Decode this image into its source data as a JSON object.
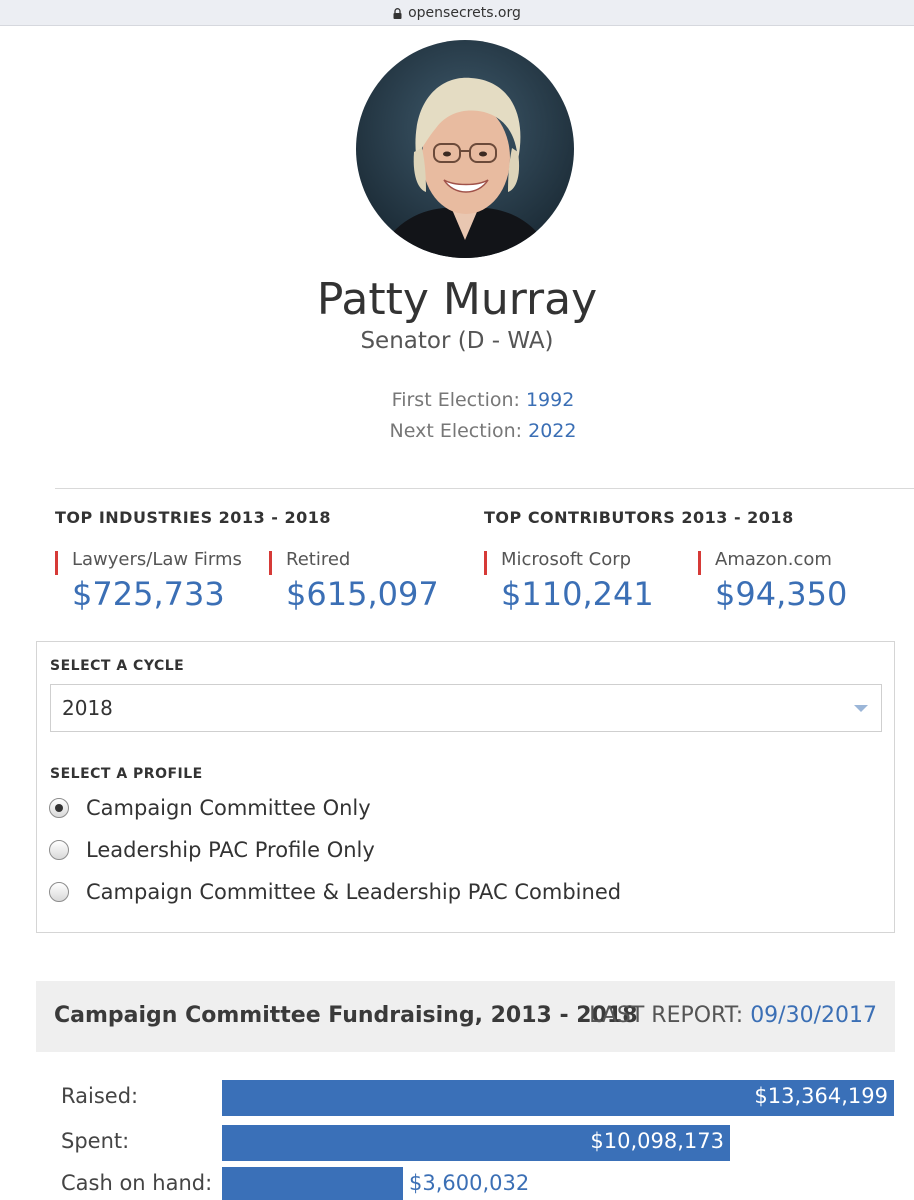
{
  "browser": {
    "url": "opensecrets.org"
  },
  "profile": {
    "name": "Patty Murray",
    "title": "Senator (D - WA)",
    "first_election_label": "First Election:",
    "first_election": "1992",
    "next_election_label": "Next Election:",
    "next_election": "2022"
  },
  "industries": {
    "heading": "TOP INDUSTRIES 2013 - 2018",
    "items": [
      {
        "label": "Lawyers/Law Firms",
        "amount": "$725,733"
      },
      {
        "label": "Retired",
        "amount": "$615,097"
      }
    ]
  },
  "contributors": {
    "heading": "TOP CONTRIBUTORS 2013 - 2018",
    "items": [
      {
        "label": "Microsoft Corp",
        "amount": "$110,241"
      },
      {
        "label": "Amazon.com",
        "amount": "$94,350"
      }
    ]
  },
  "cycle": {
    "heading": "SELECT A CYCLE",
    "selected": "2018"
  },
  "profile_select": {
    "heading": "SELECT A PROFILE",
    "options": [
      {
        "label": "Campaign Committee Only",
        "checked": true
      },
      {
        "label": "Leadership PAC Profile Only",
        "checked": false
      },
      {
        "label": "Campaign Committee & Leadership PAC Combined",
        "checked": false
      }
    ]
  },
  "fundraising": {
    "title": "Campaign Committee Fundraising, 2013 - 2018",
    "last_report_label": "LAST REPORT:",
    "last_report": "09/30/2017",
    "rows": [
      {
        "label": "Raised:",
        "amount": "$13,364,199",
        "value": 13364199
      },
      {
        "label": "Spent:",
        "amount": "$10,098,173",
        "value": 10098173
      },
      {
        "label": "Cash on hand:",
        "amount": "$3,600,032",
        "value": 3600032
      }
    ]
  },
  "colors": {
    "accent": "#3b6fb5",
    "bar": "#3a70b8",
    "marker": "#d63a37"
  }
}
